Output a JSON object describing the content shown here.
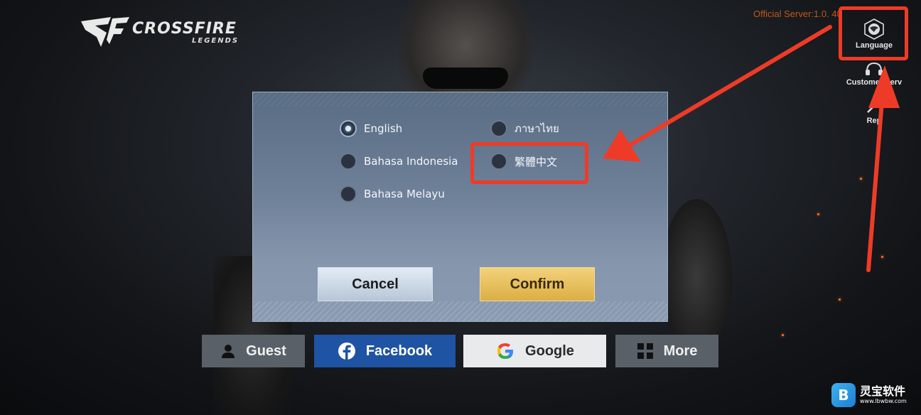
{
  "brand": {
    "logo_text": "CROSSFIRE",
    "logo_sub": "LEGENDS"
  },
  "server": {
    "label": "Official Server:1.0.    40"
  },
  "side_menu": {
    "language": "Language",
    "customer_service": "Customer Serv",
    "report": "Rep"
  },
  "language_dialog": {
    "options": [
      {
        "label": "English",
        "selected": true
      },
      {
        "label": "ภาษาไทย",
        "selected": false
      },
      {
        "label": "Bahasa Indonesia",
        "selected": false
      },
      {
        "label": "繁體中文",
        "selected": false
      },
      {
        "label": "Bahasa Melayu",
        "selected": false
      }
    ],
    "cancel_label": "Cancel",
    "confirm_label": "Confirm"
  },
  "login": {
    "guest": "Guest",
    "facebook": "Facebook",
    "google": "Google",
    "more": "More"
  },
  "watermark": {
    "title": "灵宝软件",
    "url": "www.lbwbw.com",
    "logo_glyph": "B"
  },
  "colors": {
    "highlight": "#ee3b27",
    "server_text": "#c2561b",
    "facebook_blue": "#1f53a4",
    "confirm_gold": "#dcae45"
  }
}
